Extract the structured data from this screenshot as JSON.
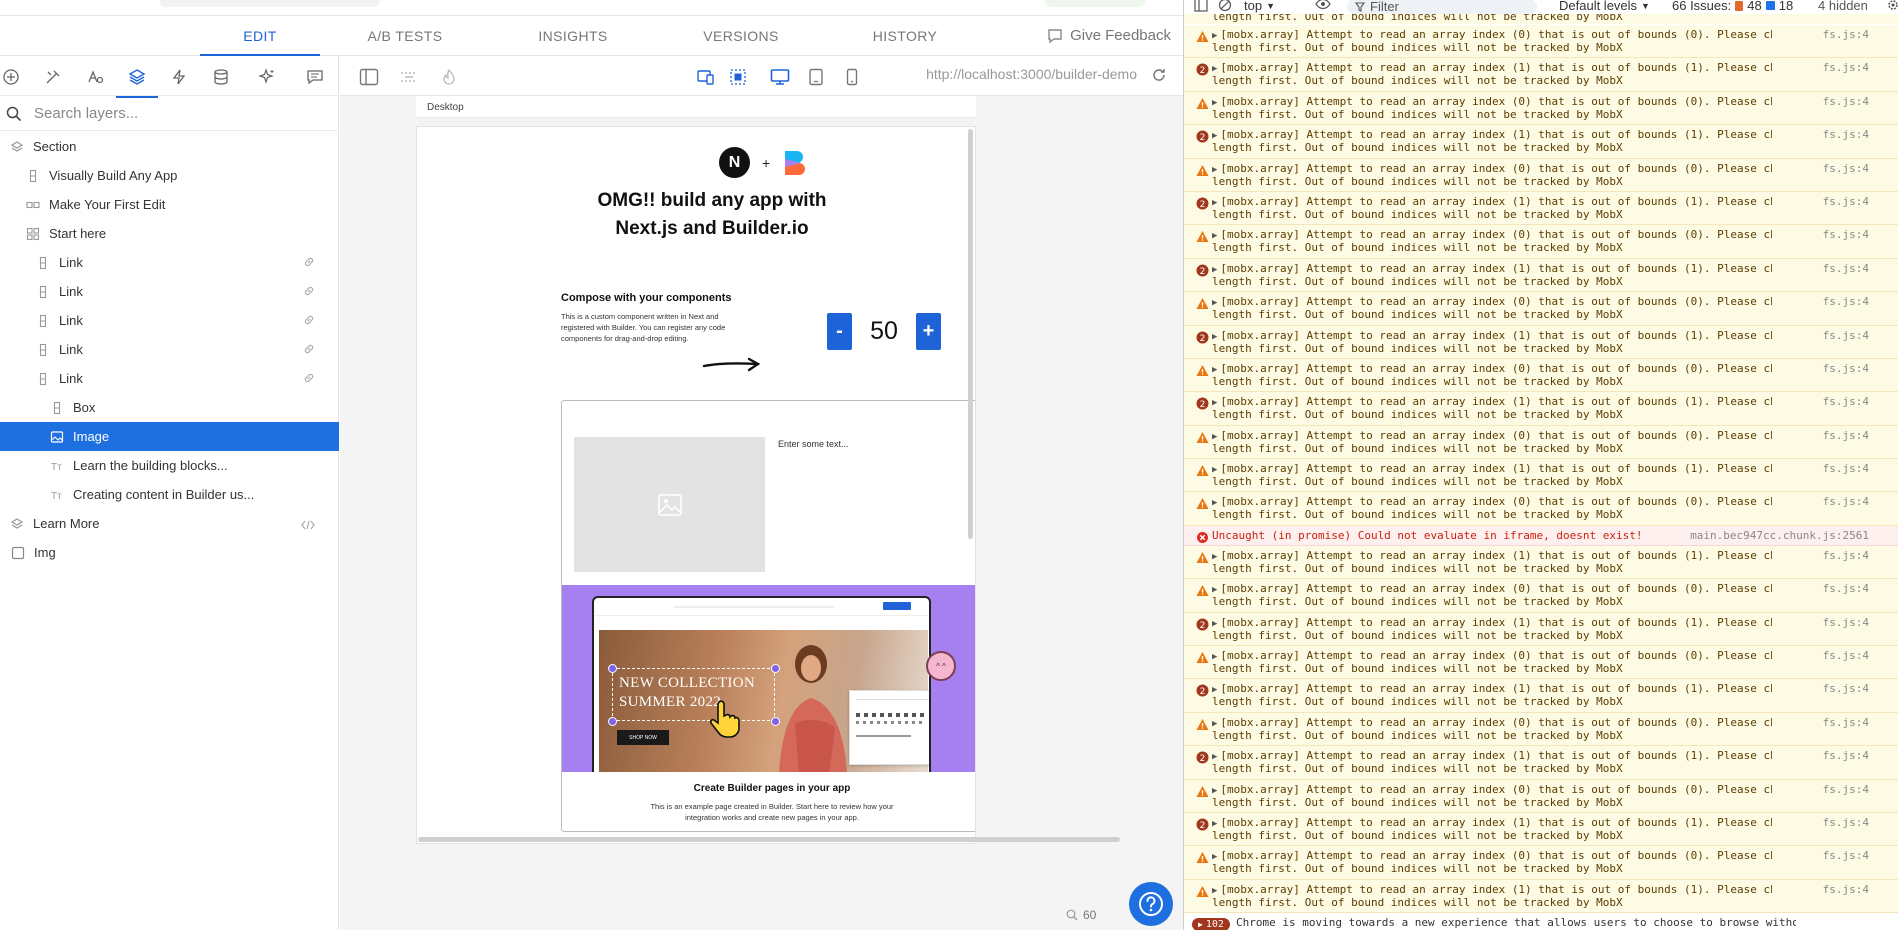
{
  "editor": {
    "tabs": [
      {
        "label": "EDIT",
        "active": true
      },
      {
        "label": "A/B TESTS",
        "active": false
      },
      {
        "label": "INSIGHTS",
        "active": false
      },
      {
        "label": "VERSIONS",
        "active": false
      },
      {
        "label": "HISTORY",
        "active": false
      }
    ],
    "feedback_label": "Give Feedback",
    "panel_icons": [
      "add-icon",
      "tools-icon",
      "style-icon",
      "layers-icon",
      "lightning-icon",
      "database-icon",
      "sparkle-icon",
      "comment-icon"
    ],
    "search_placeholder": "Search layers...",
    "layers": [
      {
        "label": "Section",
        "indent": 0,
        "icon": "section-icon"
      },
      {
        "label": "Visually Build Any App",
        "indent": 1,
        "icon": "column-icon"
      },
      {
        "label": "Make Your First Edit",
        "indent": 1,
        "icon": "row-icon"
      },
      {
        "label": "Start here",
        "indent": 1,
        "icon": "grid-icon"
      },
      {
        "label": "Link",
        "indent": 2,
        "icon": "column-icon",
        "link": true
      },
      {
        "label": "Link",
        "indent": 2,
        "icon": "column-icon",
        "link": true
      },
      {
        "label": "Link",
        "indent": 2,
        "icon": "column-icon",
        "link": true
      },
      {
        "label": "Link",
        "indent": 2,
        "icon": "column-icon",
        "link": true
      },
      {
        "label": "Link",
        "indent": 2,
        "icon": "column-icon",
        "link": true
      },
      {
        "label": "Box",
        "indent": 3,
        "icon": "column-icon"
      },
      {
        "label": "Image",
        "indent": 3,
        "icon": "image-icon",
        "selected": true
      },
      {
        "label": "Learn the building blocks...",
        "indent": 3,
        "icon": "text-icon"
      },
      {
        "label": "Creating content in Builder us...",
        "indent": 3,
        "icon": "text-icon"
      },
      {
        "label": "Learn More",
        "indent": 0,
        "icon": "section-icon",
        "code": true
      },
      {
        "label": "Img",
        "indent": 0,
        "icon": "checkbox-icon"
      }
    ],
    "url": "http://localhost:3000/builder-demo",
    "device_label": "Desktop",
    "zoom": "60"
  },
  "preview": {
    "plus": "+",
    "next_letter": "N",
    "headline": "OMG!! build any app with Next.js and Builder.io",
    "compose_title": "Compose with your components",
    "compose_body": "This is a custom component written in Next and registered with Builder. You can register any code components for drag-and-drop editing.",
    "minus": "-",
    "count": "50",
    "plus_btn": "+",
    "enter_text": "Enter some text...",
    "collection_line1": "NEW COLLECTION",
    "collection_line2": "SUMMER 2022",
    "shop_now": "SHOP NOW",
    "card_title": "Create Builder pages in your app",
    "card_body": "This is an example page created in Builder. Start here to review how your integration works and create new pages in your app."
  },
  "devtools": {
    "context": "top",
    "filter_placeholder": "Filter",
    "levels": "Default levels",
    "issues_label": "66 Issues:",
    "issues_warn": "48",
    "issues_info": "18",
    "hidden": "4 hidden",
    "warn_line2": "length first. Out of bound indices will not be tracked by MobX",
    "source": "fs.js:4",
    "error_msg": "Uncaught (in promise) Could not evaluate in iframe, doesnt exist!",
    "error_src": "main.bec947cc.chunk.js:2561",
    "last_count": "102",
    "last_msg": "Chrome is moving towards a new experience that allows users to choose to browse without",
    "top_partial": "length first. Out of bound indices will not be tracked by MobX",
    "messages": [
      {
        "type": "warn",
        "text": "[mobx.array] Attempt to read an array index (0) that is out of bounds (0). Please check"
      },
      {
        "type": "count",
        "count": "2",
        "text": "[mobx.array] Attempt to read an array index (1) that is out of bounds (1). Please check"
      },
      {
        "type": "warn",
        "text": "[mobx.array] Attempt to read an array index (0) that is out of bounds (0). Please check"
      },
      {
        "type": "count",
        "count": "2",
        "text": "[mobx.array] Attempt to read an array index (1) that is out of bounds (1). Please check"
      },
      {
        "type": "warn",
        "text": "[mobx.array] Attempt to read an array index (0) that is out of bounds (0). Please check"
      },
      {
        "type": "count",
        "count": "2",
        "text": "[mobx.array] Attempt to read an array index (1) that is out of bounds (1). Please check"
      },
      {
        "type": "warn",
        "text": "[mobx.array] Attempt to read an array index (0) that is out of bounds (0). Please check"
      },
      {
        "type": "count",
        "count": "2",
        "text": "[mobx.array] Attempt to read an array index (1) that is out of bounds (1). Please check"
      },
      {
        "type": "warn",
        "text": "[mobx.array] Attempt to read an array index (0) that is out of bounds (0). Please check"
      },
      {
        "type": "count",
        "count": "2",
        "text": "[mobx.array] Attempt to read an array index (1) that is out of bounds (1). Please check"
      },
      {
        "type": "warn",
        "text": "[mobx.array] Attempt to read an array index (0) that is out of bounds (0). Please check"
      },
      {
        "type": "count",
        "count": "2",
        "text": "[mobx.array] Attempt to read an array index (1) that is out of bounds (1). Please check"
      },
      {
        "type": "warn",
        "text": "[mobx.array] Attempt to read an array index (0) that is out of bounds (0). Please check"
      },
      {
        "type": "warn",
        "text": "[mobx.array] Attempt to read an array index (1) that is out of bounds (1). Please check"
      },
      {
        "type": "warn",
        "text": "[mobx.array] Attempt to read an array index (0) that is out of bounds (0). Please check"
      },
      {
        "type": "error"
      },
      {
        "type": "warn",
        "text": "[mobx.array] Attempt to read an array index (1) that is out of bounds (1). Please check"
      },
      {
        "type": "warn",
        "text": "[mobx.array] Attempt to read an array index (0) that is out of bounds (0). Please check"
      },
      {
        "type": "count",
        "count": "2",
        "text": "[mobx.array] Attempt to read an array index (1) that is out of bounds (1). Please check"
      },
      {
        "type": "warn",
        "text": "[mobx.array] Attempt to read an array index (0) that is out of bounds (0). Please check"
      },
      {
        "type": "count",
        "count": "2",
        "text": "[mobx.array] Attempt to read an array index (1) that is out of bounds (1). Please check"
      },
      {
        "type": "warn",
        "text": "[mobx.array] Attempt to read an array index (0) that is out of bounds (0). Please check"
      },
      {
        "type": "count",
        "count": "2",
        "text": "[mobx.array] Attempt to read an array index (1) that is out of bounds (1). Please check"
      },
      {
        "type": "warn",
        "text": "[mobx.array] Attempt to read an array index (0) that is out of bounds (0). Please check"
      },
      {
        "type": "count",
        "count": "2",
        "text": "[mobx.array] Attempt to read an array index (1) that is out of bounds (1). Please check"
      },
      {
        "type": "warn",
        "text": "[mobx.array] Attempt to read an array index (0) that is out of bounds (0). Please check"
      },
      {
        "type": "warn",
        "text": "[mobx.array] Attempt to read an array index (1) that is out of bounds (1). Please check"
      }
    ]
  },
  "colors": {
    "accent": "#1e63d8",
    "selected": "#1e6fe0",
    "purple": "#a67ff0",
    "warn_bg": "#fefbe4",
    "count_badge": "#a2361d"
  }
}
